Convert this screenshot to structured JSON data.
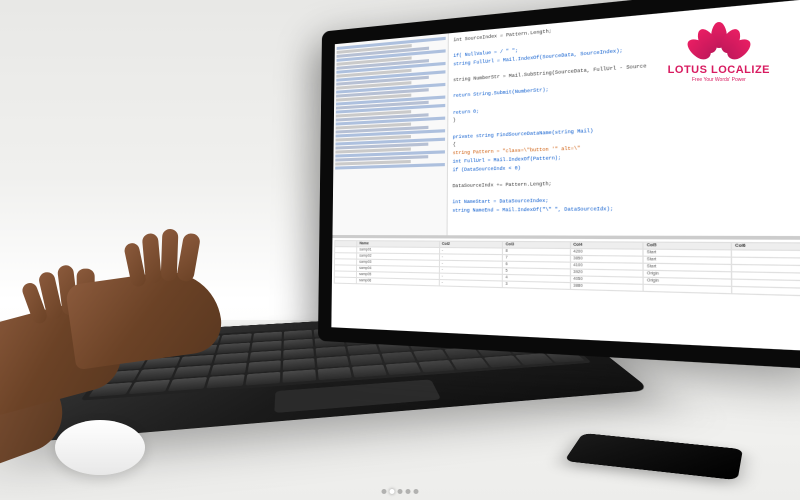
{
  "logo": {
    "brand": "LOTUS LOCALIZE",
    "tagline": "Free Your Words' Power"
  },
  "ide": {
    "code_lines": [
      {
        "t": "int SourceIndex = Pattern.Length;",
        "cls": ""
      },
      {
        "t": "",
        "cls": ""
      },
      {
        "t": "if( NullValue = / \" \";",
        "cls": "kw"
      },
      {
        "t": "string FullUrl = Mail.IndexOf(SourceData, SourceIndex);",
        "cls": "kw"
      },
      {
        "t": "",
        "cls": ""
      },
      {
        "t": "string NumberStr = Mail.SubString(SourceData, FullUrl - Source",
        "cls": ""
      },
      {
        "t": "",
        "cls": ""
      },
      {
        "t": "return String.Submit(NumberStr);",
        "cls": "kw"
      },
      {
        "t": "",
        "cls": ""
      },
      {
        "t": "return 0;",
        "cls": "kw"
      },
      {
        "t": "}",
        "cls": ""
      },
      {
        "t": "",
        "cls": ""
      },
      {
        "t": "private string FindSourceDataName(string Mail)",
        "cls": "kw"
      },
      {
        "t": "{",
        "cls": ""
      },
      {
        "t": "string Pattern = \"class=\\\"button '\" alt=\\\"",
        "cls": "str"
      },
      {
        "t": "int FullUrl = Mail.IndexOf(Pattern);",
        "cls": "kw"
      },
      {
        "t": "if (DataSourceIndx < 0)",
        "cls": "kw"
      },
      {
        "t": "",
        "cls": ""
      },
      {
        "t": "DataSourceIndx += Pattern.Length;",
        "cls": ""
      },
      {
        "t": "",
        "cls": ""
      },
      {
        "t": "int NameStart = DataSourceIndex;",
        "cls": "kw"
      },
      {
        "t": "string NameEnd = Mail.IndexOf(\"\\\" \", DataSourceIdx);",
        "cls": "kw"
      }
    ],
    "table": {
      "headers": [
        "",
        "Name",
        "Col2",
        "Col3",
        "Col4",
        "Col5",
        "Col6"
      ],
      "rows": [
        [
          "",
          "samp01",
          "-",
          "8",
          "4200",
          "Start",
          ""
        ],
        [
          "",
          "samp02",
          "-",
          "7",
          "3850",
          "Start",
          ""
        ],
        [
          "",
          "samp03",
          "-",
          "6",
          "4100",
          "Start",
          ""
        ],
        [
          "",
          "samp04",
          "-",
          "5",
          "3920",
          "Origin",
          ""
        ],
        [
          "",
          "samp05",
          "-",
          "4",
          "4050",
          "Origin",
          ""
        ],
        [
          "",
          "samp06",
          "-",
          "3",
          "3880",
          "",
          ""
        ]
      ]
    }
  }
}
